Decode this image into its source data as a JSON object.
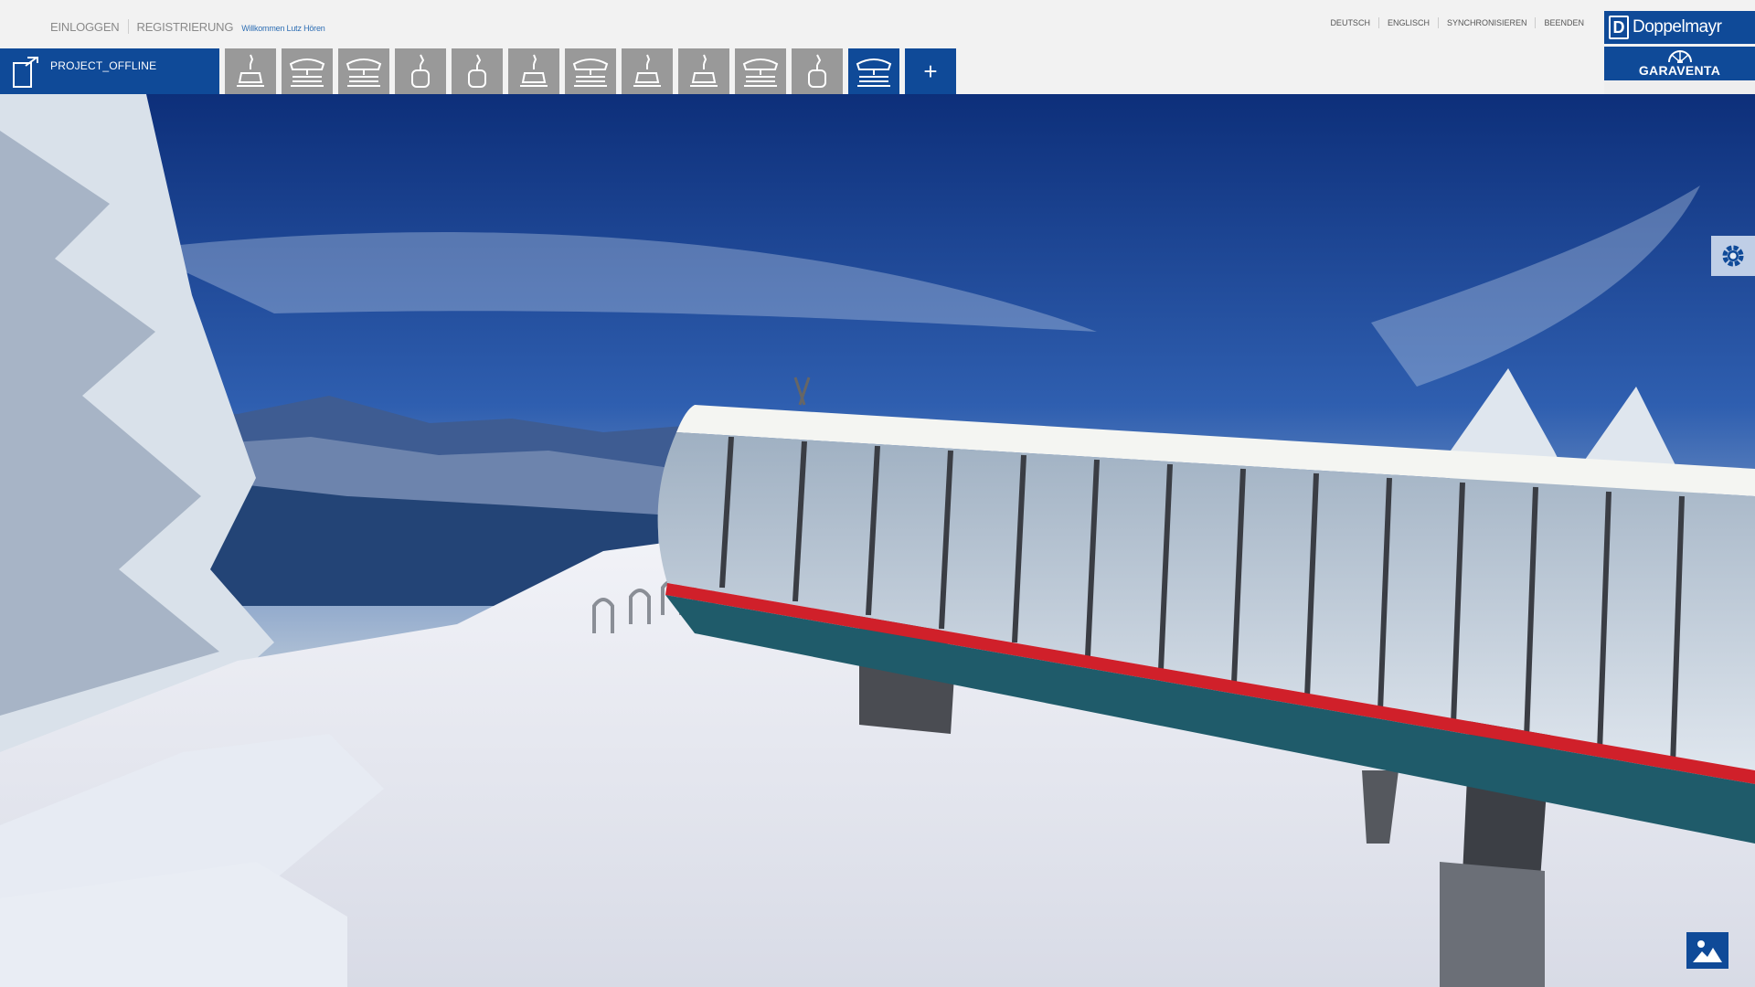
{
  "auth": {
    "login": "EINLOGGEN",
    "register": "REGISTRIERUNG",
    "welcome": "Willkommen Lutz Hören"
  },
  "topnav": {
    "items": [
      "DEUTSCH",
      "ENGLISCH",
      "SYNCHRONISIEREN",
      "BEENDEN"
    ]
  },
  "branding": {
    "doppelmayr": "Doppelmayr",
    "garaventa": "GARAVENTA"
  },
  "project": {
    "title": "PROJECT_OFFLINE",
    "icon": "document-icon"
  },
  "lift_tiles": [
    {
      "icon": "chairlift-icon",
      "active": false
    },
    {
      "icon": "covered-chairlift-icon",
      "active": false
    },
    {
      "icon": "covered-chairlift-icon",
      "active": false
    },
    {
      "icon": "gondola-icon",
      "active": false
    },
    {
      "icon": "gondola-icon",
      "active": false
    },
    {
      "icon": "chairlift-icon",
      "active": false
    },
    {
      "icon": "covered-chairlift-icon",
      "active": false
    },
    {
      "icon": "chairlift-icon",
      "active": false
    },
    {
      "icon": "chairlift-icon",
      "active": false
    },
    {
      "icon": "covered-chairlift-icon",
      "active": false
    },
    {
      "icon": "gondola-icon",
      "active": false
    },
    {
      "icon": "covered-chairlift-icon",
      "active": true
    }
  ],
  "add_button": "+",
  "controls": {
    "settings_icon": "gear-icon",
    "image_icon": "image-icon"
  },
  "colors": {
    "brand_blue": "#0f4a98",
    "tile_gray": "#999999",
    "topbar_bg": "#f2f2f2"
  }
}
